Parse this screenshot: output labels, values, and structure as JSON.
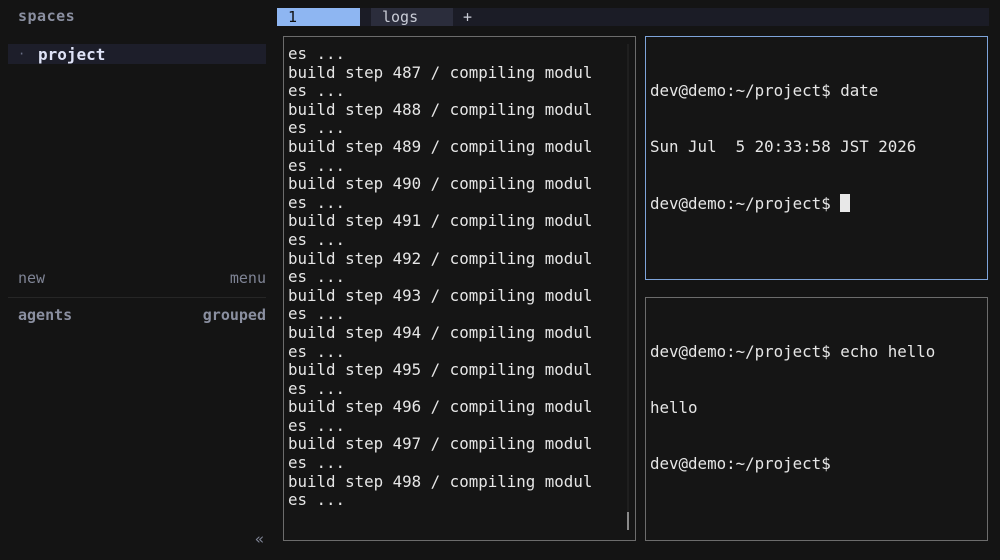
{
  "sidebar": {
    "heading": "spaces",
    "items": [
      {
        "bullet": "·",
        "label": "project"
      }
    ],
    "new_label": "new",
    "menu_label": "menu",
    "agents_label": "agents",
    "grouped_label": "grouped",
    "collapse_label": "«"
  },
  "tabs": [
    {
      "label": "1",
      "active": true
    },
    {
      "label": "logs",
      "active": false
    }
  ],
  "tab_add_label": "+",
  "panes": {
    "left": {
      "lines": [
        "es ...",
        "build step 487 / compiling modul",
        "es ...",
        "build step 488 / compiling modul",
        "es ...",
        "build step 489 / compiling modul",
        "es ...",
        "build step 490 / compiling modul",
        "es ...",
        "build step 491 / compiling modul",
        "es ...",
        "build step 492 / compiling modul",
        "es ...",
        "build step 493 / compiling modul",
        "es ...",
        "build step 494 / compiling modul",
        "es ...",
        "build step 495 / compiling modul",
        "es ...",
        "build step 496 / compiling modul",
        "es ...",
        "build step 497 / compiling modul",
        "es ...",
        "build step 498 / compiling modul",
        "es ..."
      ]
    },
    "top_right": {
      "lines": [
        "dev@demo:~/project$ date",
        "Sun Jul  5 20:33:58 JST 2026"
      ],
      "prompt": "dev@demo:~/project$ "
    },
    "bottom_right": {
      "lines": [
        "dev@demo:~/project$ echo hello",
        "hello",
        "dev@demo:~/project$"
      ]
    }
  },
  "colors": {
    "active_tab": "#8eb6f2",
    "focused_pane_border": "#7ea4da",
    "pane_border": "#6c6c6c",
    "background": "#141414"
  }
}
